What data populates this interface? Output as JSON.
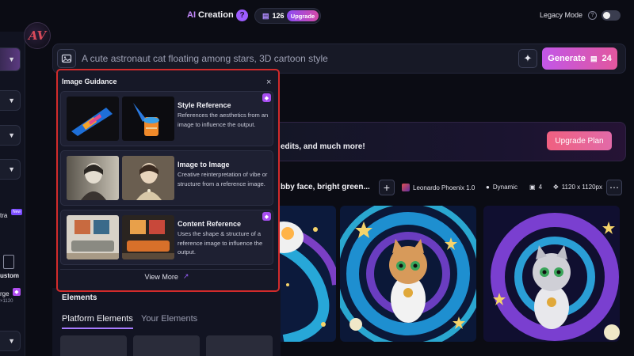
{
  "header": {
    "title_ai": "AI",
    "title_rest": " Creation",
    "help_icon": "question-icon",
    "tokens": "126",
    "upgrade_label": "Upgrade",
    "legacy_label": "Legacy Mode",
    "legacy_mode_on": false,
    "logo_text": "AV"
  },
  "sidebar": {
    "items": [
      {
        "type": "dropdown",
        "icon": "chevron-down-icon"
      },
      {
        "type": "dropdown",
        "icon": "chevron-down-icon"
      },
      {
        "type": "dropdown",
        "icon": "chevron-down-icon"
      },
      {
        "type": "dropdown",
        "icon": "chevron-down-icon"
      }
    ],
    "ultra_label": "tra",
    "new_badge": "New",
    "custom_label": "ustom",
    "large_label": "rge",
    "large_size": "×1120"
  },
  "prompt": {
    "placeholder": "A cute astronaut cat floating among stars, 3D cartoon style",
    "generate_label": "Generate",
    "generate_cost": "24"
  },
  "banner": {
    "text": "edits, and much more!",
    "button": "Upgrade Plan"
  },
  "generation": {
    "prompt_excerpt": "bby face, bright green...",
    "model": "Leonardo Phoenix 1.0",
    "style": "Dynamic",
    "count": "4",
    "dimensions": "1120 x 1120px"
  },
  "guidance": {
    "title": "Image Guidance",
    "cards": [
      {
        "title": "Style Reference",
        "desc": "References the aesthetics from an image to influence the output.",
        "premium": true
      },
      {
        "title": "Image to Image",
        "desc": "Creative reinterpretation of vibe or structure from a reference image.",
        "premium": false
      },
      {
        "title": "Content Reference",
        "desc": "Uses the shape & structure of a reference image to influence the output.",
        "premium": true
      }
    ],
    "view_more": "View More"
  },
  "elements": {
    "title": "Elements",
    "tabs": [
      {
        "label": "Platform Elements",
        "active": true
      },
      {
        "label": "Your Elements",
        "active": false
      }
    ]
  },
  "colors": {
    "accent": "#a77bff",
    "generate_gradient_start": "#c257e8",
    "generate_gradient_end": "#e2579e",
    "highlight_border": "#d22b2b"
  }
}
